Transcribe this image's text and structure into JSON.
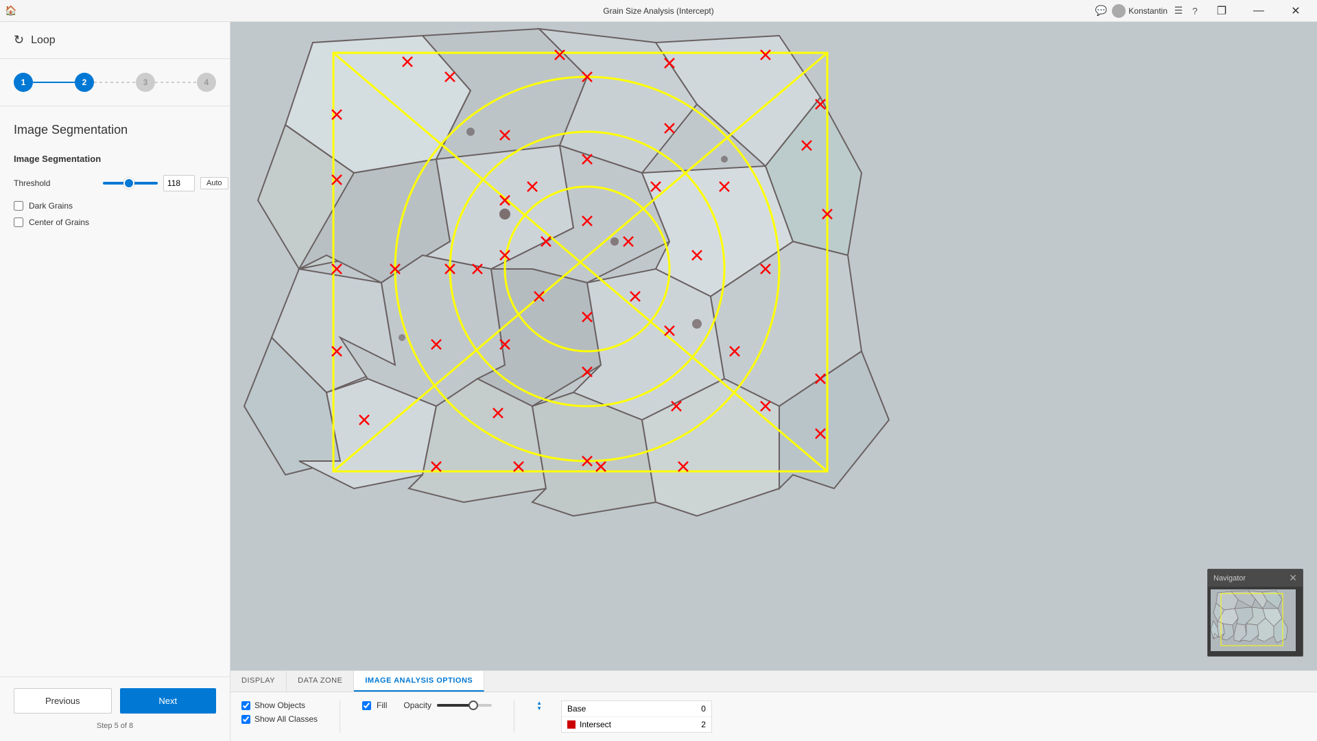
{
  "titlebar": {
    "title": "Grain Size Analysis (Intercept)",
    "user": "Konstantin",
    "buttons": {
      "chat": "💬",
      "menu": "☰",
      "help": "?",
      "restore": "❐",
      "minimize": "—",
      "close": "✕"
    }
  },
  "sidebar": {
    "loop_label": "Loop",
    "steps": [
      {
        "num": "1",
        "state": "done"
      },
      {
        "num": "2",
        "state": "active"
      },
      {
        "num": "3",
        "state": "todo"
      },
      {
        "num": "4",
        "state": "todo"
      }
    ],
    "section_title": "Image Segmentation",
    "subsection_title": "Image Segmentation",
    "threshold_label": "Threshold",
    "threshold_value": "118",
    "threshold_placeholder": "118",
    "auto_label": "Auto",
    "dark_grains_label": "Dark Grains",
    "center_of_grains_label": "Center of Grains",
    "prev_label": "Previous",
    "next_label": "Next",
    "step_info": "Step 5 of 8"
  },
  "tabs": [
    {
      "id": "display",
      "label": "DISPLAY"
    },
    {
      "id": "datazone",
      "label": "DATA ZONE"
    },
    {
      "id": "imageoptions",
      "label": "IMAGE ANALYSIS OPTIONS"
    }
  ],
  "active_tab": "imageoptions",
  "bottom_panel": {
    "show_objects_label": "Show Objects",
    "show_all_classes_label": "Show All Classes",
    "fill_label": "Fill",
    "opacity_label": "Opacity",
    "table": {
      "rows": [
        {
          "name": "Base",
          "color": null,
          "value": "0"
        },
        {
          "name": "Intersect",
          "color": "#cc0000",
          "value": "2"
        }
      ]
    }
  },
  "navigator": {
    "title": "Navigator",
    "close": "✕"
  }
}
